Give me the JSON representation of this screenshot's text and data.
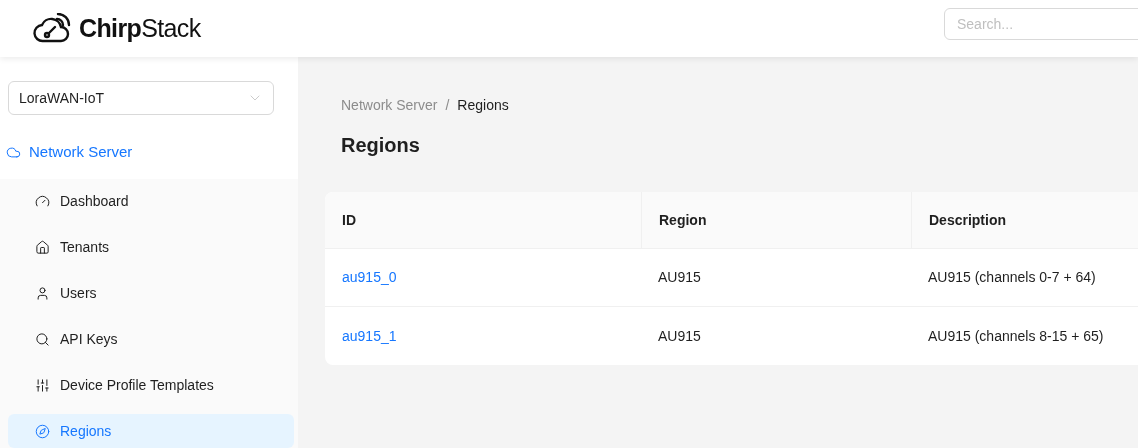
{
  "header": {
    "logo": "**Chirp**Stack",
    "search": {
      "placeholder": "Search..."
    }
  },
  "sidebar": {
    "tenant_select": {
      "value": "LoraWAN-IoT"
    },
    "section": {
      "label": "Network Server",
      "kind": "cloud"
    },
    "items": [
      {
        "label": "Dashboard",
        "kind": "gauge",
        "selected": false
      },
      {
        "label": "Tenants",
        "kind": "home",
        "selected": false
      },
      {
        "label": "Users",
        "kind": "user",
        "selected": false
      },
      {
        "label": "API Keys",
        "kind": "key",
        "selected": false
      },
      {
        "label": "Device Profile Templates",
        "kind": "sliders",
        "selected": false
      },
      {
        "label": "Regions",
        "kind": "compass",
        "selected": true
      }
    ]
  },
  "breadcrumb": [
    {
      "label": "Network Server",
      "current": false
    },
    {
      "label": "Regions",
      "current": true
    }
  ],
  "separator": "/",
  "title": "Regions",
  "table": {
    "columns": [
      "ID",
      "Region",
      "Description"
    ],
    "rows": [
      [
        "au915_0",
        "AU915",
        "AU915 (channels 0-7 + 64)"
      ],
      [
        "au915_1",
        "AU915",
        "AU915 (channels 8-15 + 65)"
      ]
    ]
  }
}
